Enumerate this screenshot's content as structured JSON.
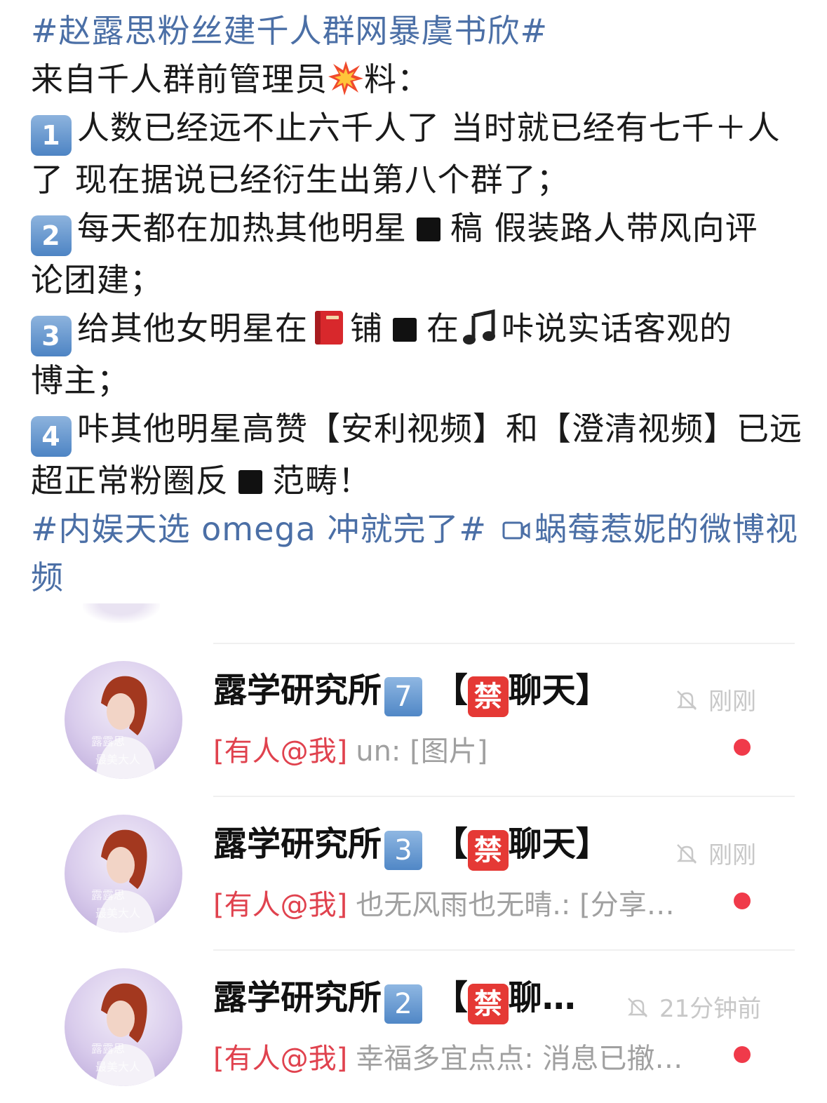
{
  "post": {
    "hashtag_title": "#赵露思粉丝建千人群网暴虞书欣#",
    "intro_prefix": "来自千人群前管理员",
    "intro_suffix": "料：",
    "item1": {
      "num": "1",
      "line1": "人数已经远不止六千人了 当时就已经有七千＋人",
      "line2": "了 现在据说已经衍生出第八个群了；"
    },
    "item2": {
      "num": "2",
      "part1": "每天都在加热其他明星",
      "part2": "稿 假装路人带风向评",
      "line2": "论团建；"
    },
    "item3": {
      "num": "3",
      "part1": "给其他女明星在",
      "part2": "铺",
      "part3": "在",
      "part4": "咔说实话客观的",
      "line2": "博主；"
    },
    "item4": {
      "num": "4",
      "line1": "咔其他明星高赞【安利视频】和【澄清视频】已远",
      "part1": "超正常粉圈反",
      "part2": "范畴！"
    },
    "footer_hashtag": "#内娱天选 omega 冲就完了#",
    "video_link_line1": "蜗莓惹妮的微博视",
    "video_link_line2": "频"
  },
  "chats": [
    {
      "name": "露学研究所",
      "num": "7",
      "tag_open": "【",
      "ban": "禁",
      "tag_rest": "聊天】",
      "time": "刚刚",
      "at": "[有人@我]",
      "preview": "un: [图片]"
    },
    {
      "name": "露学研究所",
      "num": "3",
      "tag_open": "【",
      "ban": "禁",
      "tag_rest": "聊天】",
      "time": "刚刚",
      "at": "[有人@我]",
      "preview": "也无风雨也无晴.: [分享…"
    },
    {
      "name": "露学研究所",
      "num": "2",
      "tag_open": "【",
      "ban": "禁",
      "tag_rest": "聊…",
      "time": "21分钟前",
      "at": "[有人@我]",
      "preview": "幸福多宜点点: 消息已撤…"
    }
  ],
  "colors": {
    "link": "#4b6fa6",
    "at_red": "#e0424e",
    "dot_red": "#f03a4a",
    "ban_red": "#e53935"
  },
  "icons": [
    "collision-emoji",
    "red-book-emoji",
    "music-note-emoji",
    "video-icon",
    "bell-muted-icon"
  ]
}
